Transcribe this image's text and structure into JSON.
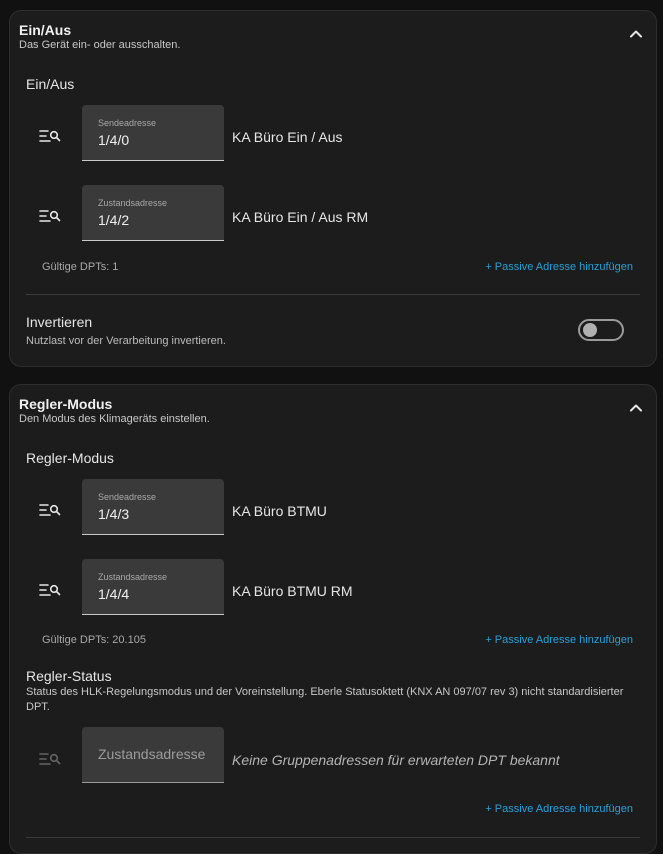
{
  "sections": [
    {
      "title": "Ein/Aus",
      "subtitle": "Das Gerät ein- oder ausschalten.",
      "group_title": "Ein/Aus",
      "rows": [
        {
          "label": "Sendeadresse",
          "value": "1/4/0",
          "description": "KA Büro Ein / Aus"
        },
        {
          "label": "Zustandsadresse",
          "value": "1/4/2",
          "description": "KA Büro Ein / Aus RM"
        }
      ],
      "dpt_info": "Gültige DPTs: 1",
      "add_passive_label": "+ Passive Adresse hinzufügen",
      "invert": {
        "label": "Invertieren",
        "description": "Nutzlast vor der Verarbeitung invertieren.",
        "enabled": false
      }
    },
    {
      "title": "Regler-Modus",
      "subtitle": "Den Modus des Klimageräts einstellen.",
      "group_title": "Regler-Modus",
      "rows": [
        {
          "label": "Sendeadresse",
          "value": "1/4/3",
          "description": "KA Büro BTMU"
        },
        {
          "label": "Zustandsadresse",
          "value": "1/4/4",
          "description": "KA Büro BTMU RM"
        }
      ],
      "dpt_info": "Gültige DPTs: 20.105",
      "add_passive_label": "+ Passive Adresse hinzufügen",
      "status": {
        "title": "Regler-Status",
        "description": "Status des HLK-Regelungsmodus und der Voreinstellung. Eberle Statusoktett (KNX AN 097/07 rev 3) nicht standardisierter DPT.",
        "placeholder": "Zustandsadresse",
        "empty_message": "Keine Gruppenadressen für erwarteten DPT bekannt",
        "add_passive_label": "+ Passive Adresse hinzufügen"
      }
    }
  ],
  "icons": {
    "collapse": "chevron-up-icon",
    "address_search": "list-search-icon"
  },
  "colors": {
    "accent": "#2a9fd8",
    "card_bg": "#1c1c1c",
    "page_bg": "#111111",
    "field_bg": "#3a3a3a"
  }
}
